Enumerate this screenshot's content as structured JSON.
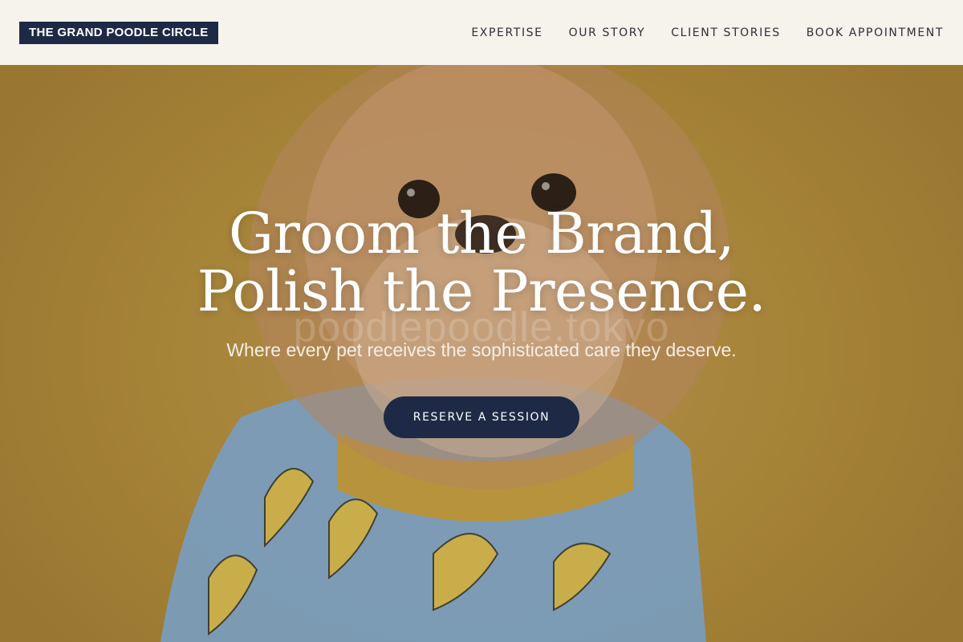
{
  "brand": {
    "name": "THE GRAND POODLE CIRCLE"
  },
  "nav": {
    "items": [
      {
        "label": "EXPERTISE"
      },
      {
        "label": "OUR STORY"
      },
      {
        "label": "CLIENT STORIES"
      },
      {
        "label": "BOOK APPOINTMENT"
      }
    ]
  },
  "hero": {
    "headline_line1": "Groom the Brand,",
    "headline_line2": "Polish the Presence.",
    "watermark": "poodlepoodle.tokyo",
    "subheadline": "Where every pet receives the sophisticated care they deserve.",
    "cta_label": "RESERVE A SESSION"
  },
  "colors": {
    "header_bg": "#f6f2ec",
    "brand_bg": "#1e2a45",
    "cta_bg": "#1e2a45",
    "hero_bg": "#b9943f"
  }
}
